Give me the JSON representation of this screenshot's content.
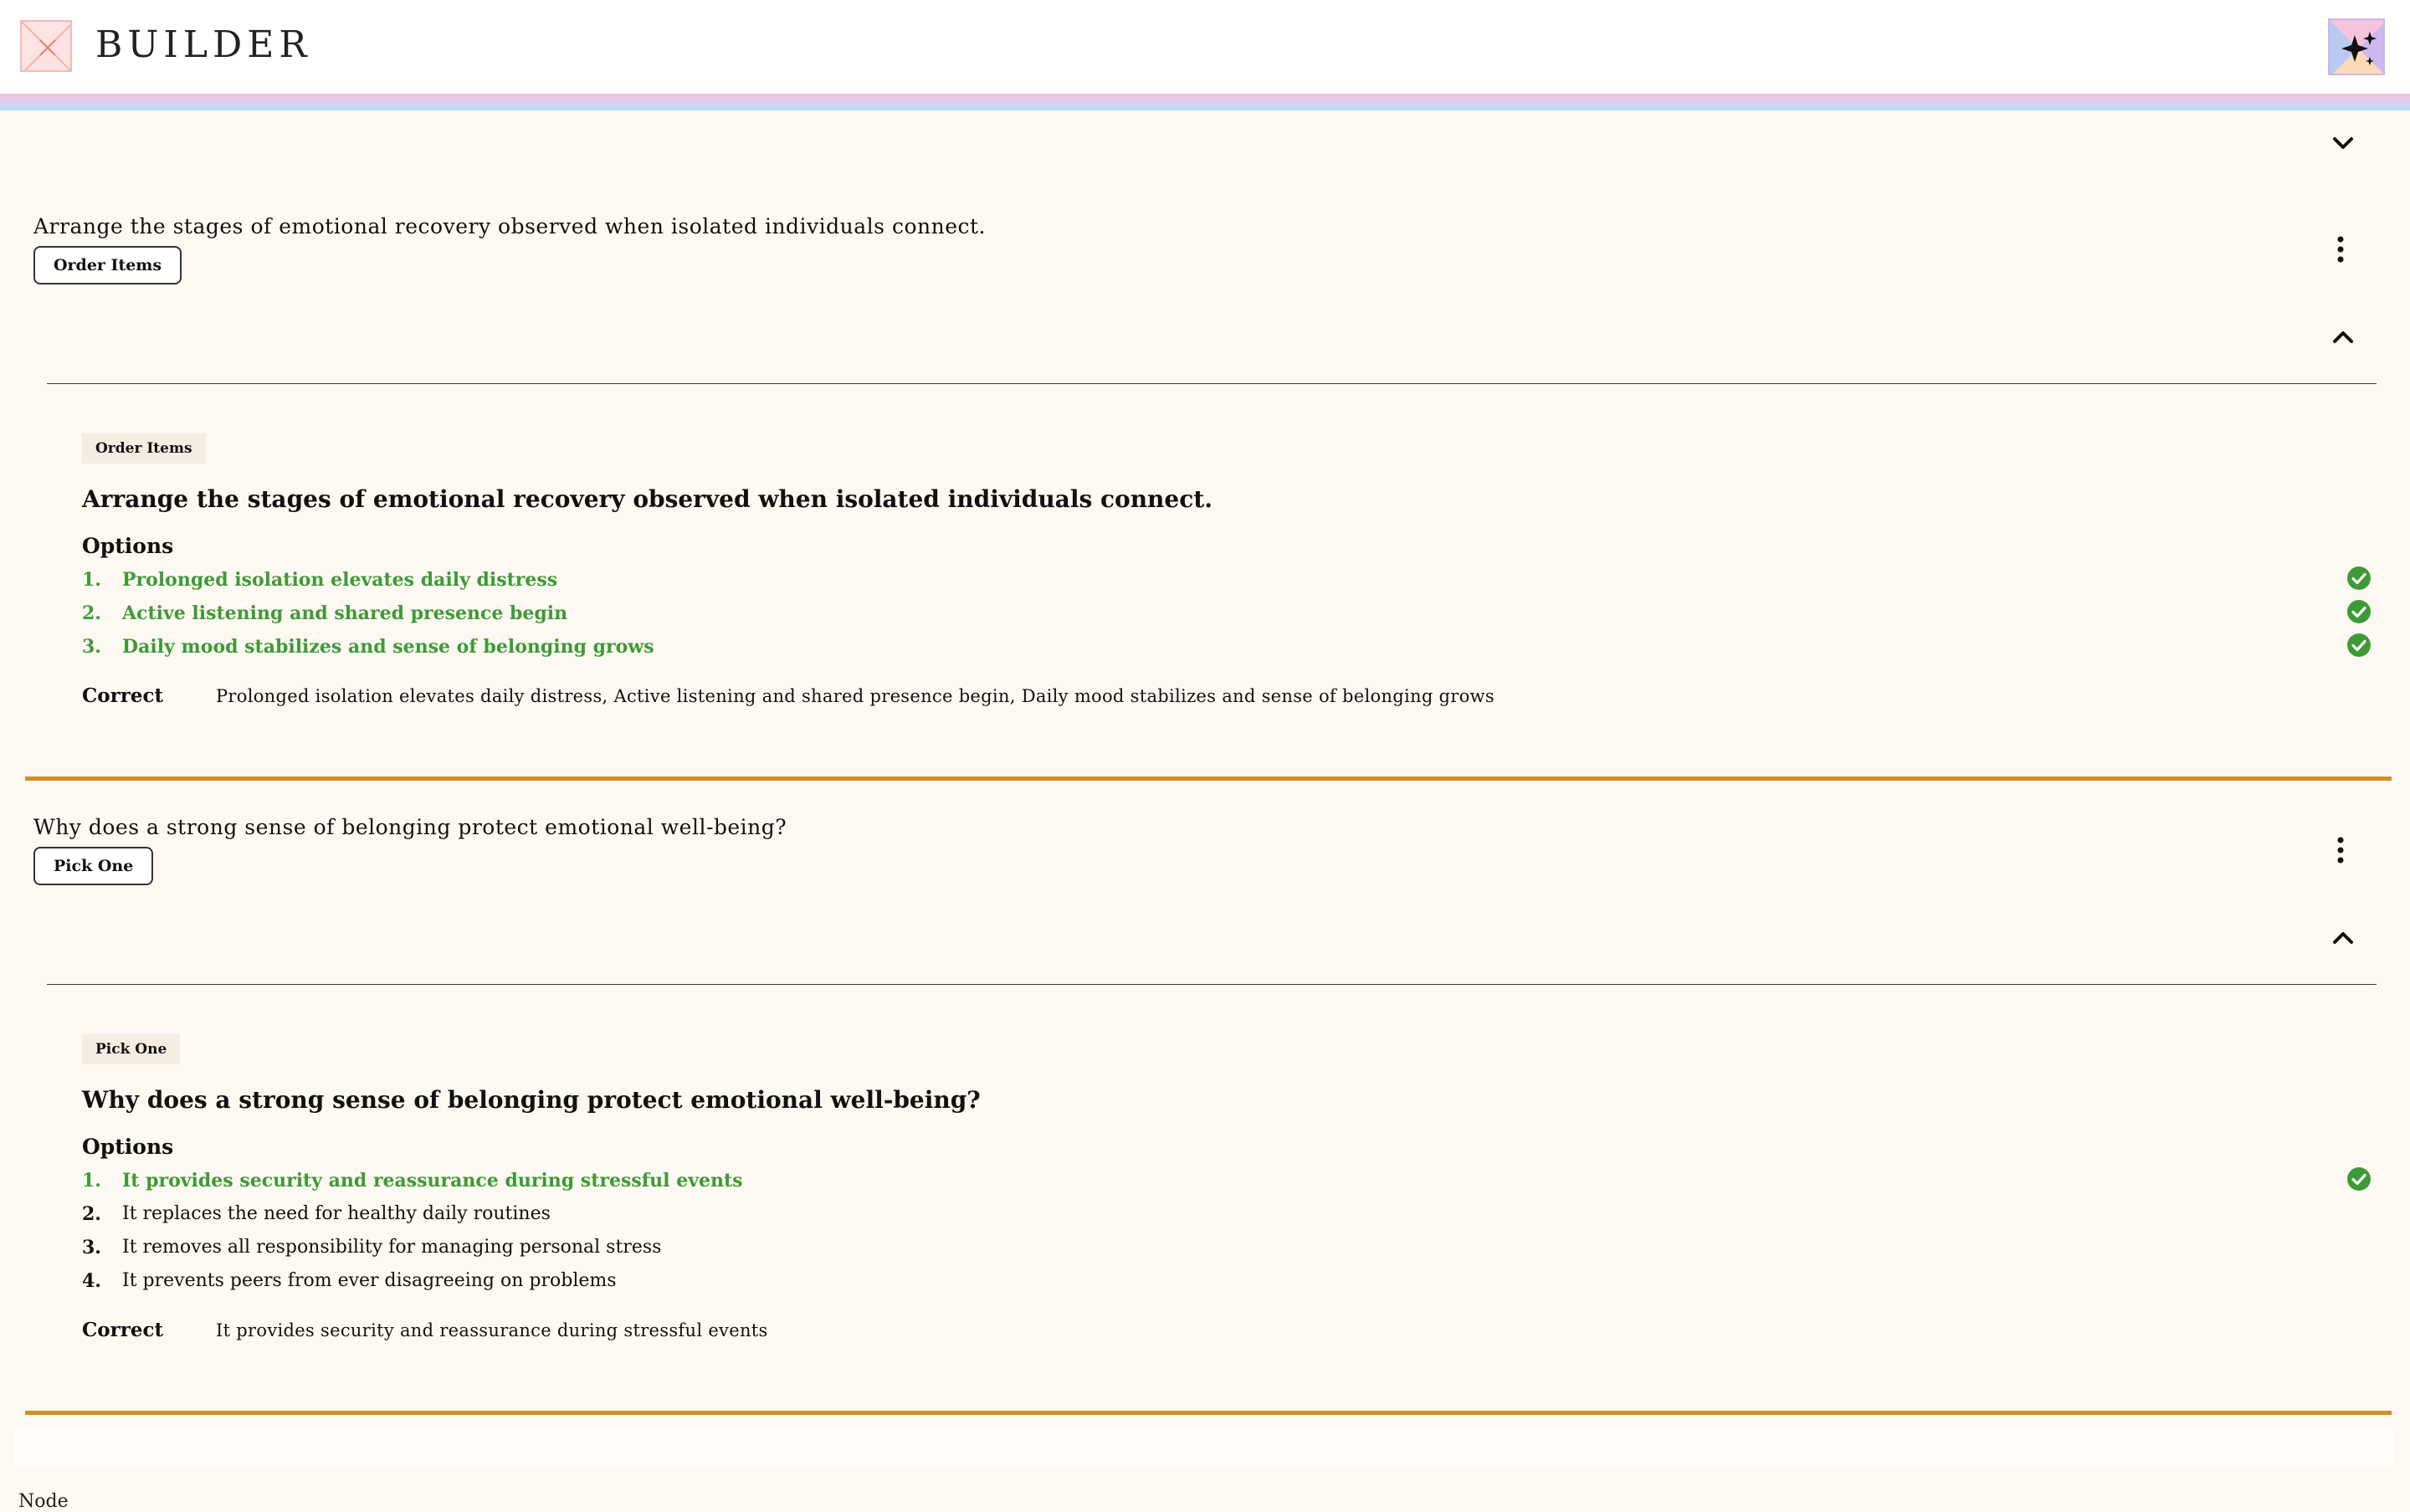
{
  "header": {
    "brand": "BUILDER",
    "logo_icon": "broken-image-icon",
    "ai_icon": "sparkles-icon",
    "stripe_colors": [
      "#f2c3dc",
      "#e9c8ec",
      "#d7d0f2",
      "#c8daf3",
      "#bcd9f0",
      "#fdf8f2"
    ]
  },
  "questions": [
    {
      "prompt": "Arrange the stages of emotional recovery observed when isolated individuals connect.",
      "type_label": "Order Items",
      "preview": {
        "label": "Order Items",
        "question": "Arrange the stages of emotional recovery observed when isolated individuals connect.",
        "options_heading": "Options",
        "options": [
          {
            "num": "1.",
            "text": "Prolonged isolation elevates daily distress",
            "correct": true
          },
          {
            "num": "2.",
            "text": "Active listening and shared presence begin",
            "correct": true
          },
          {
            "num": "3.",
            "text": "Daily mood stabilizes and sense of belonging grows",
            "correct": true
          }
        ],
        "correct_label": "Correct",
        "correct_value": "Prolonged isolation elevates daily distress, Active listening and shared presence begin, Daily mood stabilizes and sense of belonging grows"
      }
    },
    {
      "prompt": "Why does a strong sense of belonging protect emotional well-being?",
      "type_label": "Pick One",
      "preview": {
        "label": "Pick One",
        "question": "Why does a strong sense of belonging protect emotional well-being?",
        "options_heading": "Options",
        "options": [
          {
            "num": "1.",
            "text": "It provides security and reassurance during stressful events",
            "correct": true
          },
          {
            "num": "2.",
            "text": "It replaces the need for healthy daily routines",
            "correct": false
          },
          {
            "num": "3.",
            "text": "It removes all responsibility for managing personal stress",
            "correct": false
          },
          {
            "num": "4.",
            "text": "It prevents peers from ever disagreeing on problems",
            "correct": false
          }
        ],
        "correct_label": "Correct",
        "correct_value": "It provides security and reassurance during stressful events"
      }
    }
  ],
  "colors": {
    "correct_green": "#3e9a36",
    "separator_gold": "#d08f2a",
    "panel_bg": "#fdf8f2"
  },
  "footer": {
    "text": "Node"
  }
}
